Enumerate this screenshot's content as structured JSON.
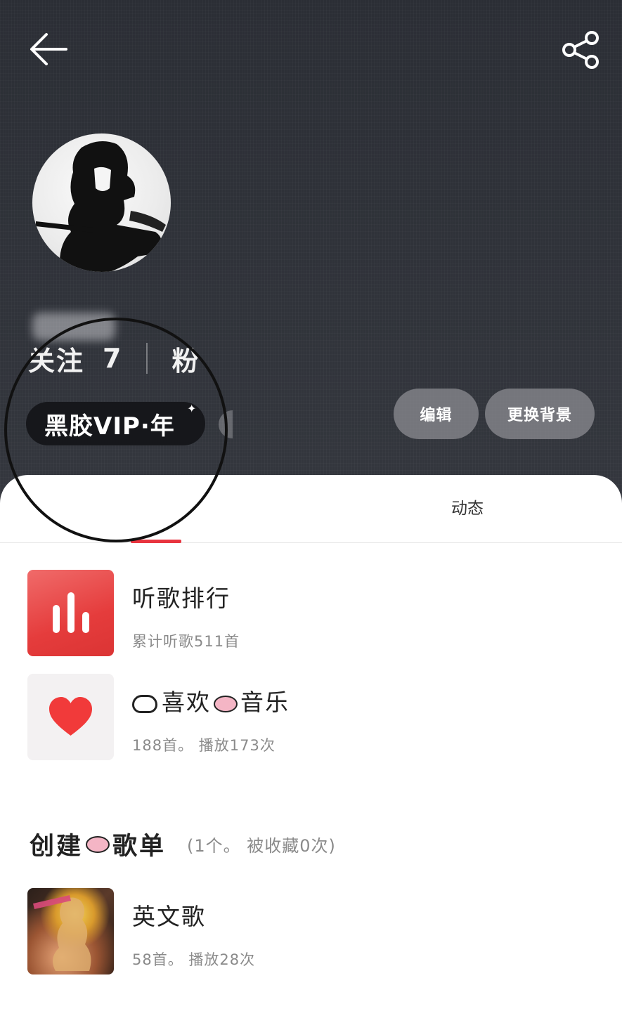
{
  "header": {
    "follow_label": "关注",
    "follow_count": "7",
    "fans_partial": "粉",
    "vip_badge": "黑胶VIP·年",
    "edit_button": "编辑",
    "change_bg_button": "更换背景"
  },
  "tabs": {
    "dongtai": "动态"
  },
  "items": [
    {
      "title": "听歌排行",
      "subtitle": "累计听歌511首"
    },
    {
      "title_main": "喜欢",
      "title_tail": "音乐",
      "subtitle": "188首。 播放173次"
    }
  ],
  "created_section": {
    "title_left": "创建",
    "title_right": "歌单",
    "subtitle": "(1个。 被收藏0次)"
  },
  "playlists": [
    {
      "title": "英文歌",
      "subtitle": "58首。 播放28次"
    }
  ],
  "colors": {
    "accent": "#e8343f",
    "header_bg": "#2f3238"
  }
}
